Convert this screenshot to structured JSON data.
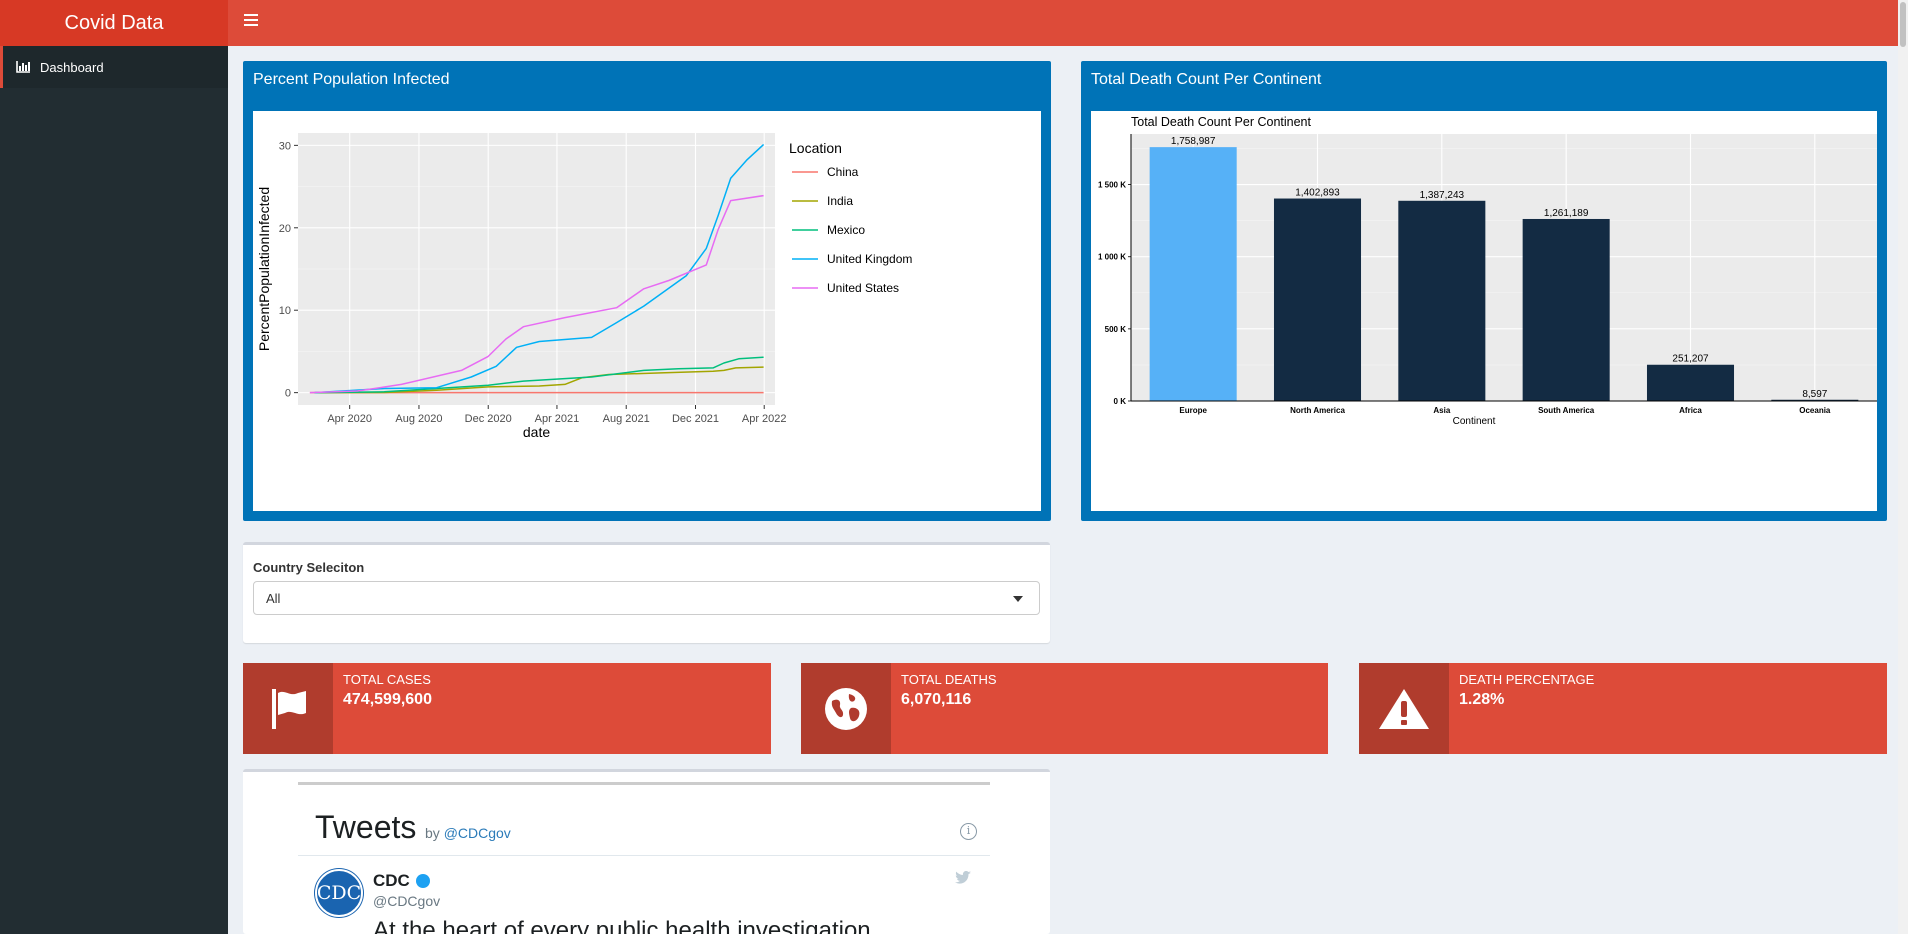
{
  "app": {
    "title": "Covid Data"
  },
  "sidebar": {
    "items": [
      {
        "label": "Dashboard",
        "icon": "bar-chart-icon"
      }
    ]
  },
  "colors": {
    "header": "#dd4b39",
    "logo": "#d73925",
    "sidebar": "#222d32",
    "box": "#0073b7"
  },
  "line_box": {
    "title": "Percent Population Infected"
  },
  "bar_box": {
    "title": "Total Death Count Per Continent"
  },
  "filter": {
    "label": "Country Seleciton",
    "selected": "All"
  },
  "info_boxes": [
    {
      "label": "TOTAL CASES",
      "value": "474,599,600",
      "icon": "flag-icon"
    },
    {
      "label": "TOTAL DEATHS",
      "value": "6,070,116",
      "icon": "globe-icon"
    },
    {
      "label": "DEATH PERCENTAGE",
      "value": "1.28%",
      "icon": "warning-icon"
    }
  ],
  "tweets": {
    "title": "Tweets",
    "by_prefix": "by",
    "handle": "@CDCgov",
    "info": "i",
    "tweet": {
      "avatar_text": "CDC",
      "name": "CDC",
      "handle": "@CDCgov",
      "text": "At the heart of every public health investigation"
    }
  },
  "chart_data": [
    {
      "type": "line",
      "title": "",
      "xlabel": "date",
      "ylabel": "PercentPopulationInfected",
      "x_ticks": [
        "Apr 2020",
        "Aug 2020",
        "Dec 2020",
        "Apr 2021",
        "Aug 2021",
        "Dec 2021",
        "Apr 2022"
      ],
      "y_ticks": [
        0,
        10,
        20,
        30
      ],
      "ylim": [
        -1.5,
        31.5
      ],
      "xlim": [
        "2020-01-01",
        "2022-04-20"
      ],
      "legend_title": "Location",
      "legend_position": "right",
      "series": [
        {
          "name": "China",
          "color": "#f8766d",
          "x": [
            "2020-01-22",
            "2022-03-31"
          ],
          "y": [
            0,
            0.01
          ]
        },
        {
          "name": "India",
          "color": "#a3a500",
          "x": [
            "2020-01-30",
            "2020-06-01",
            "2020-09-01",
            "2020-12-01",
            "2021-03-01",
            "2021-04-15",
            "2021-05-15",
            "2021-07-01",
            "2021-10-01",
            "2022-01-01",
            "2022-01-20",
            "2022-02-10",
            "2022-03-31"
          ],
          "y": [
            0,
            0.02,
            0.3,
            0.7,
            0.8,
            1.0,
            1.8,
            2.2,
            2.4,
            2.6,
            2.7,
            3.0,
            3.1
          ]
        },
        {
          "name": "Mexico",
          "color": "#00bf7d",
          "x": [
            "2020-01-30",
            "2020-06-01",
            "2020-09-01",
            "2020-12-01",
            "2021-02-01",
            "2021-06-01",
            "2021-09-01",
            "2021-11-01",
            "2022-01-01",
            "2022-01-20",
            "2022-02-15",
            "2022-03-31"
          ],
          "y": [
            0,
            0.1,
            0.5,
            0.9,
            1.4,
            1.9,
            2.7,
            2.9,
            3.0,
            3.6,
            4.1,
            4.3
          ]
        },
        {
          "name": "United Kingdom",
          "color": "#00b0f6",
          "x": [
            "2020-01-31",
            "2020-06-01",
            "2020-09-01",
            "2020-11-01",
            "2020-12-15",
            "2021-01-20",
            "2021-03-01",
            "2021-06-01",
            "2021-07-15",
            "2021-09-01",
            "2021-11-15",
            "2021-12-20",
            "2022-01-10",
            "2022-02-01",
            "2022-03-01",
            "2022-03-31"
          ],
          "y": [
            0,
            0.5,
            0.6,
            1.9,
            3.2,
            5.5,
            6.2,
            6.7,
            8.5,
            10.5,
            14.2,
            17.5,
            21.5,
            26.0,
            28.2,
            30.1
          ]
        },
        {
          "name": "United States",
          "color": "#e76bf3",
          "x": [
            "2020-01-22",
            "2020-04-15",
            "2020-07-01",
            "2020-10-15",
            "2020-12-01",
            "2021-01-01",
            "2021-02-01",
            "2021-04-15",
            "2021-07-15",
            "2021-09-01",
            "2021-10-15",
            "2021-12-20",
            "2022-01-10",
            "2022-02-01",
            "2022-03-31"
          ],
          "y": [
            0,
            0.2,
            1.0,
            2.7,
            4.4,
            6.5,
            8.0,
            9.1,
            10.3,
            12.6,
            13.6,
            15.5,
            19.8,
            23.3,
            23.9
          ]
        }
      ]
    },
    {
      "type": "bar",
      "title": "Total Death Count Per Continent",
      "xlabel": "Continent",
      "ylabel": "",
      "categories": [
        "Europe",
        "North America",
        "Asia",
        "South America",
        "Africa",
        "Oceania"
      ],
      "values": [
        1758987,
        1402893,
        1387243,
        1261189,
        251207,
        8597
      ],
      "data_labels": [
        "1,758,987",
        "1,402,893",
        "1,387,243",
        "1,261,189",
        "251,207",
        "8,597"
      ],
      "y_ticks": [
        0,
        500000,
        1000000,
        1500000
      ],
      "y_tick_labels": [
        "0 K",
        "500 K",
        "1 000 K",
        "1 500 K"
      ],
      "ylim": [
        0,
        1850000
      ],
      "highlight_color": "#56b1f7",
      "bar_color": "#132b43"
    }
  ]
}
